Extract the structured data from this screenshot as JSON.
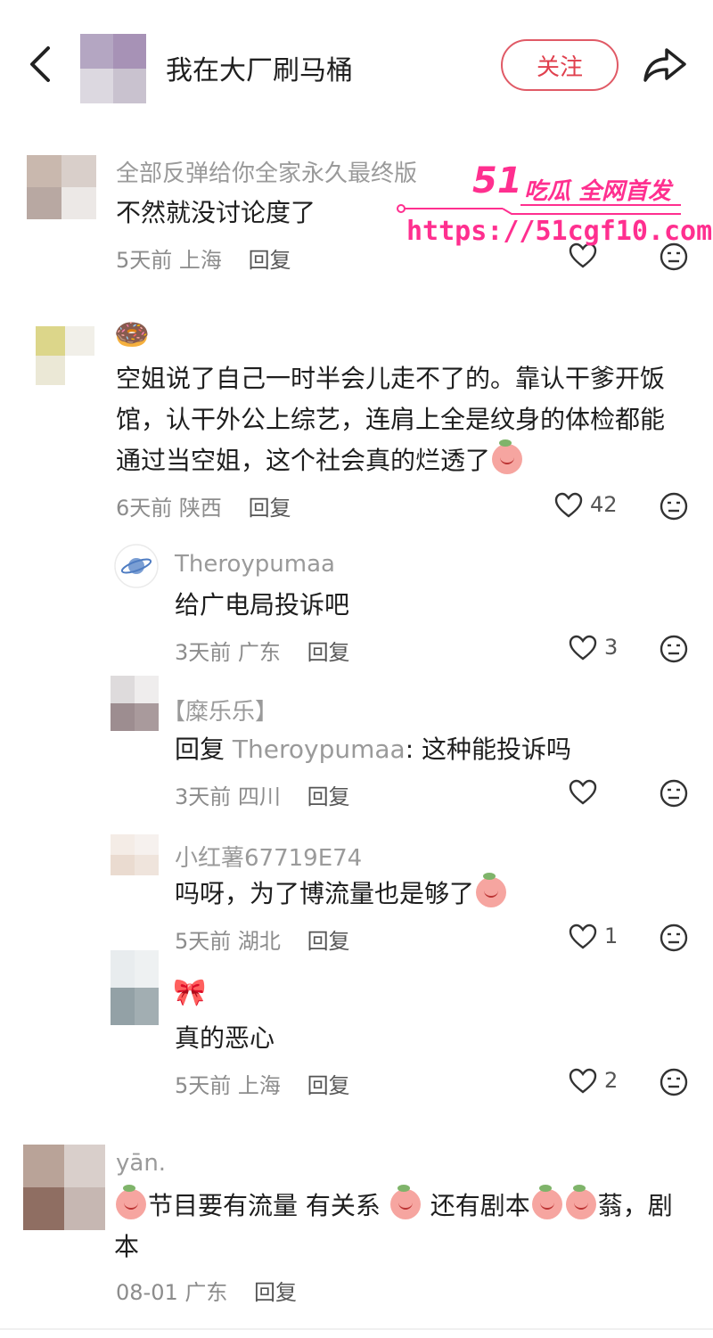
{
  "header": {
    "title": "我在大厂刷马桶",
    "follow_label": "关注"
  },
  "watermark": {
    "brand_number": "51",
    "brand_text": "吃瓜 全网首发",
    "url": "https://51cgf10.com"
  },
  "comments": [
    {
      "name": "全部反弹给你全家永久最终版",
      "text": "不然就没讨论度了",
      "time": "5天前",
      "location": "上海",
      "reply_label": "回复",
      "likes": ""
    },
    {
      "name": "🍩",
      "text_lines": [
        "空姐说了自己一时半会儿走不了的。靠认干爹开饭",
        "馆，认干外公上综艺，连肩上全是纹身的体检都能",
        "通过当空姐，这个社会真的烂透了"
      ],
      "time": "6天前",
      "location": "陕西",
      "reply_label": "回复",
      "likes": "42"
    },
    {
      "name": "Theroypumaa",
      "text": "给广电局投诉吧",
      "time": "3天前",
      "location": "广东",
      "reply_label": "回复",
      "likes": "3"
    },
    {
      "name": "【糜乐乐】",
      "reply_prefix": "回复",
      "reply_target": "Theroypumaa",
      "text": ": 这种能投诉吗",
      "time": "3天前",
      "location": "四川",
      "reply_label": "回复",
      "likes": ""
    },
    {
      "name": "小红薯67719E74",
      "text": "吗呀，为了博流量也是够了",
      "time": "5天前",
      "location": "湖北",
      "reply_label": "回复",
      "likes": "1"
    },
    {
      "name": "🎀",
      "text": "真的恶心",
      "time": "5天前",
      "location": "上海",
      "reply_label": "回复",
      "likes": "2"
    },
    {
      "name": "yān.",
      "text_part1": "节目要有流量 有关系",
      "text_part2": " 还有剧本",
      "text_part3": "蓊，剧",
      "text_line2": "本",
      "time": "08-01",
      "location": "广东",
      "reply_label": "回复",
      "likes": ""
    }
  ],
  "icons": {
    "back": "chevron-left-icon",
    "share": "share-arrow-icon",
    "like": "heart-outline-icon",
    "dislike": "neutral-face-icon"
  },
  "colors": {
    "accent": "#e0404e",
    "watermark": "#ff2f8f"
  }
}
